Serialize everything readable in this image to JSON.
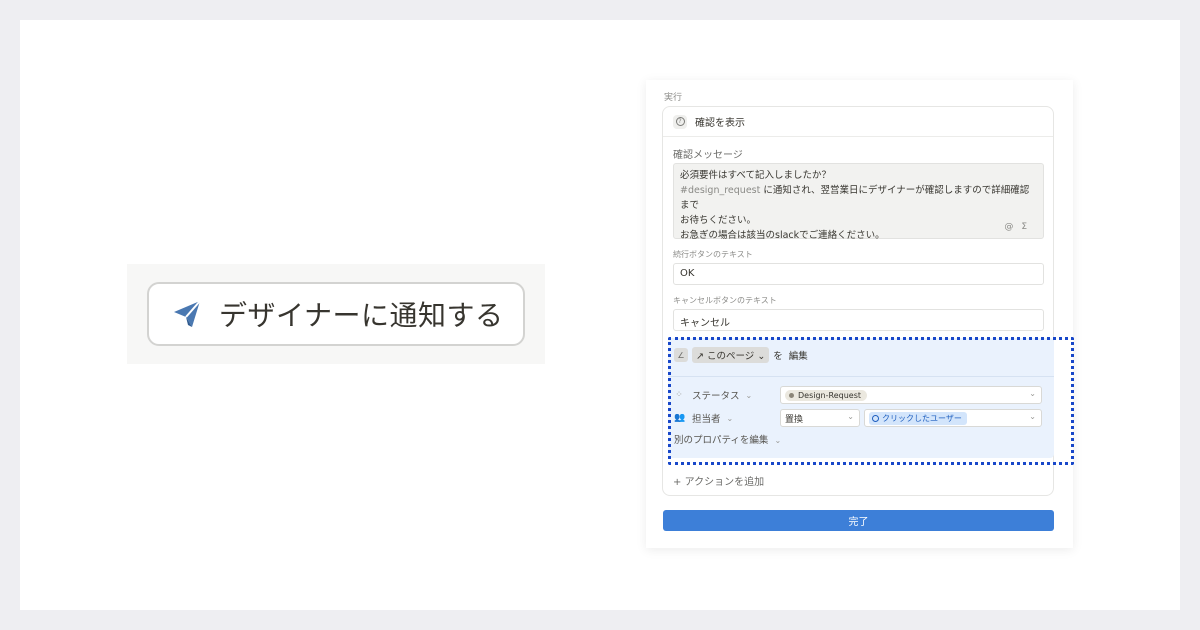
{
  "left_button": {
    "label": "デザイナーに通知する",
    "icon": "paper-plane-icon",
    "icon_color": "#4a78b1"
  },
  "panel": {
    "section_label": "実行",
    "action": {
      "title": "確認を表示",
      "confirm_message_label": "確認メッセージ",
      "confirm_message_lines": [
        "必須要件はすべて記入しましたか？",
        "#design_request",
        " に通知され、翌営業日にデザイナーが確認しますので詳細確認まで",
        "お待ちください。",
        "お急ぎの場合は該当のslackでご連絡ください。"
      ],
      "message_icons": [
        "@",
        "Σ"
      ],
      "continue_label": "続行ボタンのテキスト",
      "continue_value": "OK",
      "cancel_label": "キャンセルボタンのテキスト",
      "cancel_value": "キャンセル"
    },
    "edit": {
      "target": "このページ",
      "particle": "を",
      "verb": "編集",
      "rows": [
        {
          "property": "ステータス",
          "value": "Design-Request"
        },
        {
          "property": "担当者",
          "mode": "置換",
          "value": "クリックしたユーザー"
        }
      ],
      "more_label": "別のプロパティを編集"
    },
    "add_action": "アクションを追加",
    "done_label": "完了",
    "accent_color": "#3d7fd8",
    "highlight_color": "#1847c9"
  }
}
